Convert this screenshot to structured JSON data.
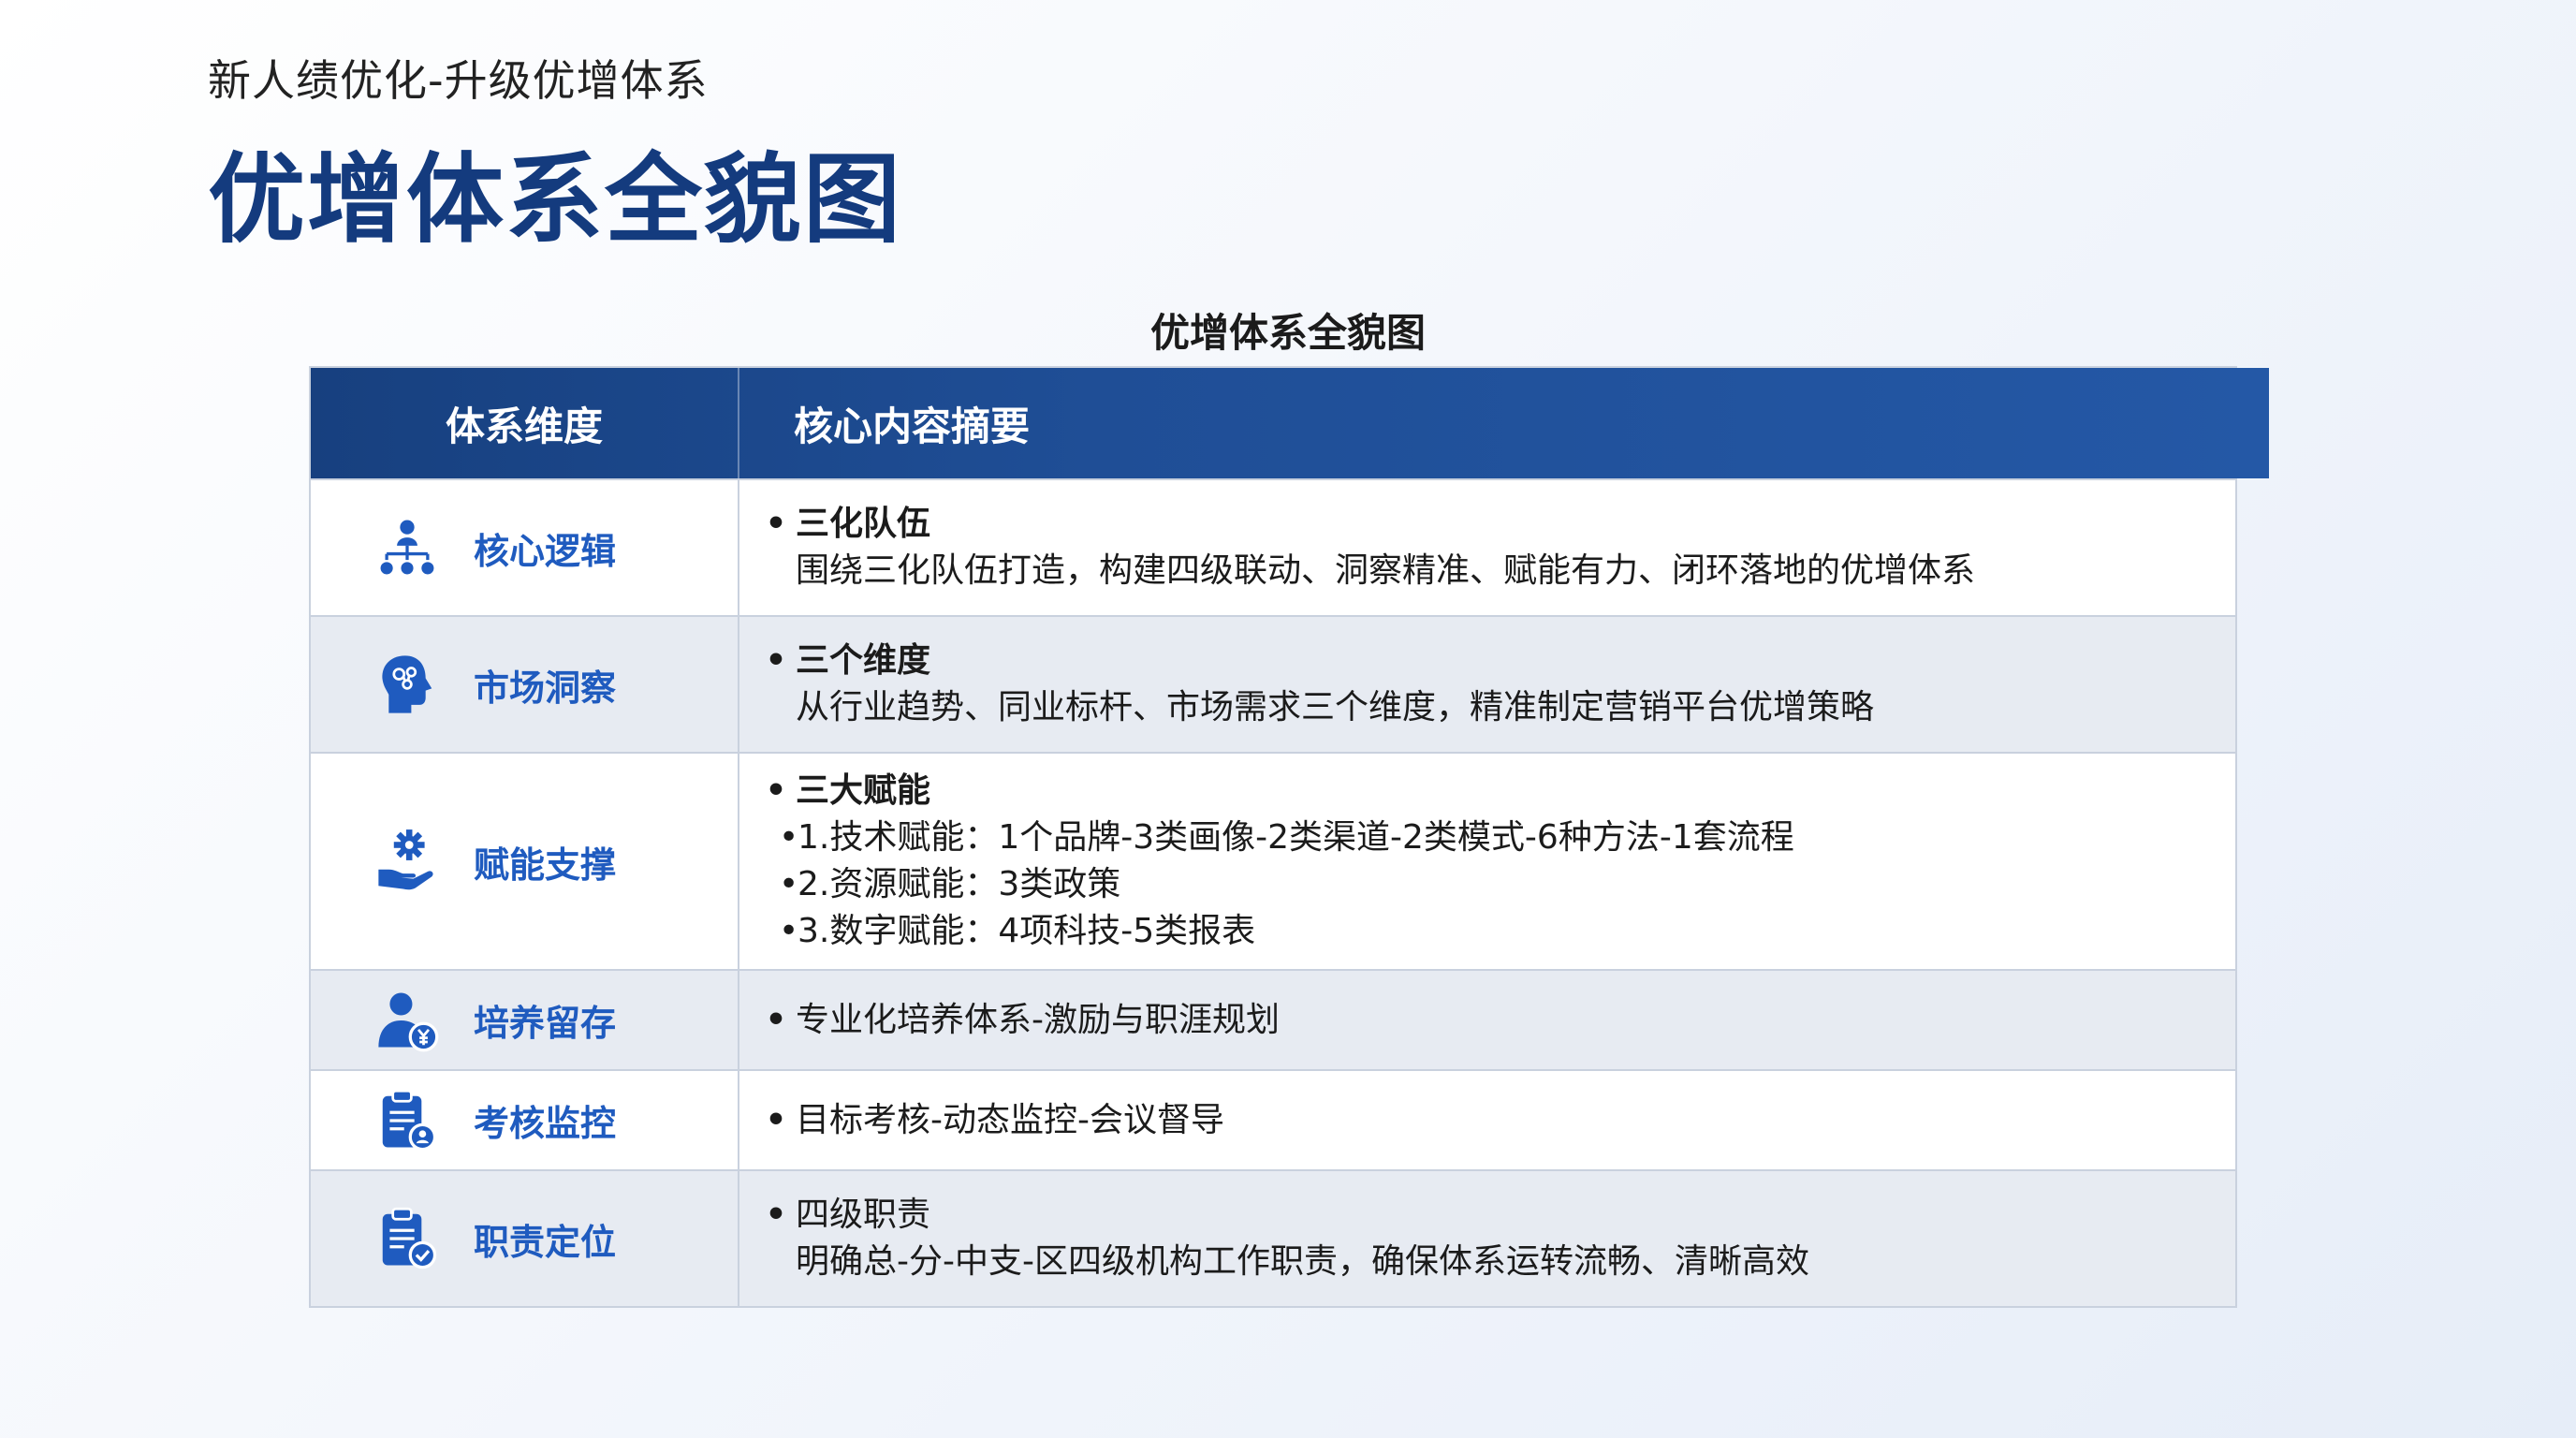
{
  "header": {
    "subtitle": "新人绩优化-升级优增体系",
    "title": "优增体系全貌图"
  },
  "table": {
    "caption": "优增体系全貌图",
    "columns": [
      "体系维度",
      "核心内容摘要"
    ],
    "rows": [
      {
        "icon": "org-hierarchy-icon",
        "dimension": "核心逻辑",
        "heading": "三化队伍",
        "lines": [
          "围绕三化队伍打造，构建四级联动、洞察精准、赋能有力、闭环落地的优增体系"
        ]
      },
      {
        "icon": "head-brain-icon",
        "dimension": "市场洞察",
        "heading": "三个维度",
        "lines": [
          "从行业趋势、同业标杆、市场需求三个维度，精准制定营销平台优增策略"
        ]
      },
      {
        "icon": "hand-gear-icon",
        "dimension": "赋能支撑",
        "heading": "三大赋能",
        "subitems": [
          "1.技术赋能：1个品牌-3类画像-2类渠道-2类模式-6种方法-1套流程",
          "2.资源赋能：3类政策",
          "3.数字赋能：4项科技-5类报表"
        ]
      },
      {
        "icon": "person-money-icon",
        "dimension": "培养留存",
        "text": "专业化培养体系-激励与职涯规划"
      },
      {
        "icon": "clipboard-person-icon",
        "dimension": "考核监控",
        "text": "目标考核-动态监控-会议督导"
      },
      {
        "icon": "clipboard-check-icon",
        "dimension": "职责定位",
        "heading_plain": "四级职责",
        "lines": [
          "明确总-分-中支-区四级机构工作职责，确保体系运转流畅、清晰高效"
        ]
      }
    ]
  },
  "colors": {
    "title": "#143b7e",
    "header_bg": "#1f4e96",
    "dimension_text": "#1f5bbf",
    "icon": "#1f5bbf",
    "row_alt": "#e7ebf2"
  }
}
